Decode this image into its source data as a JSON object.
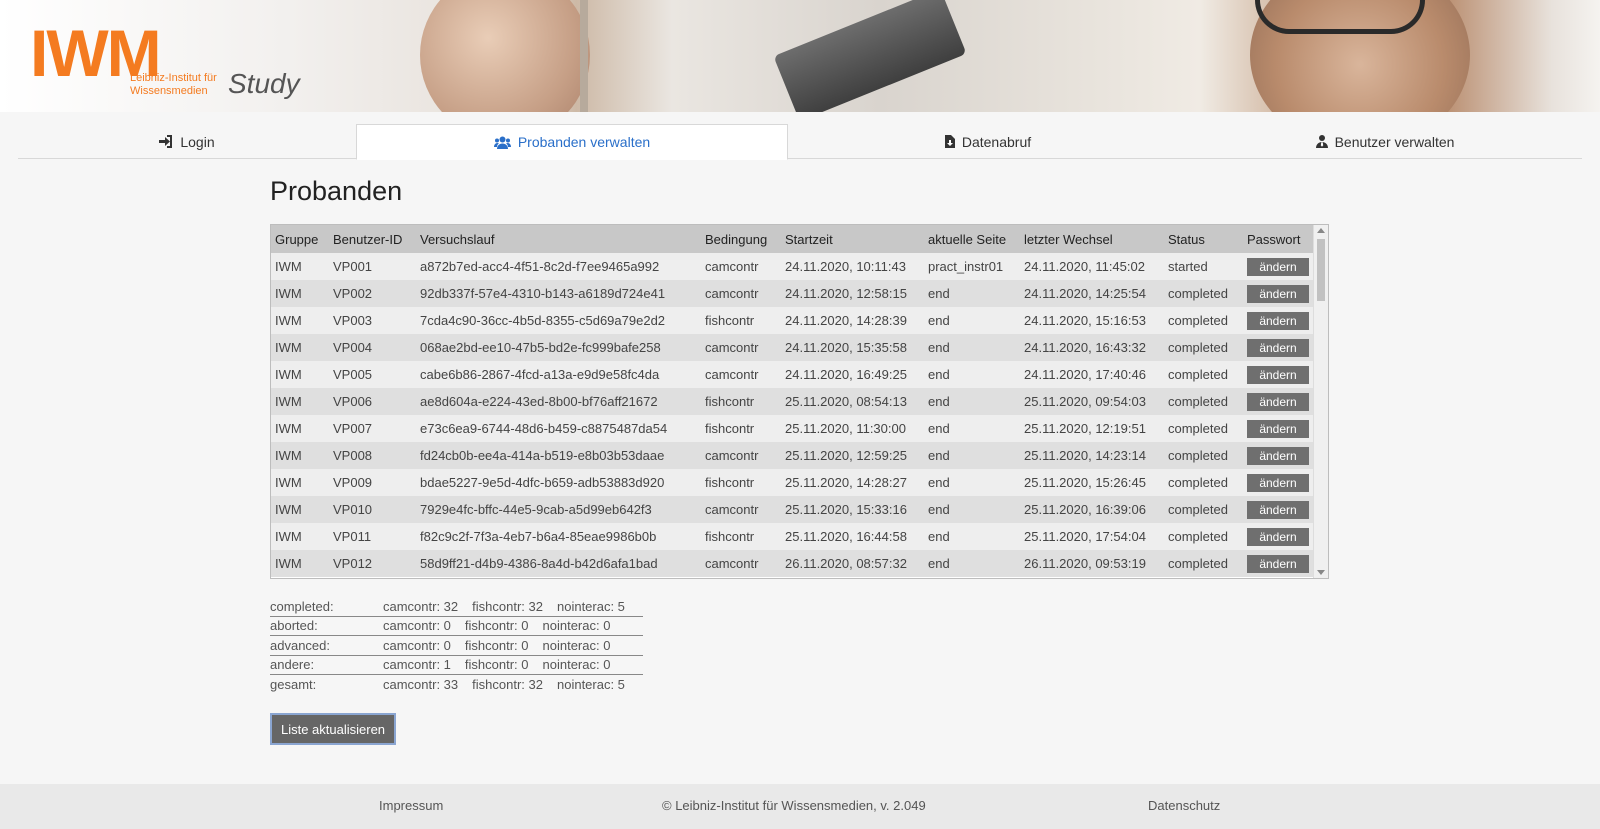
{
  "header": {
    "logo_text": "IWM",
    "logo_subtitle": "Leibniz-Institut für Wissensmedien",
    "app_name": "Study"
  },
  "tabs": [
    {
      "label": "Login",
      "icon": "sign-in-icon"
    },
    {
      "label": "Probanden verwalten",
      "icon": "users-icon",
      "active": true
    },
    {
      "label": "Datenabruf",
      "icon": "file-download-icon"
    },
    {
      "label": "Benutzer verwalten",
      "icon": "user-tie-icon"
    }
  ],
  "page_title": "Probanden",
  "table": {
    "headers": [
      "Gruppe",
      "Benutzer-ID",
      "Versuchslauf",
      "Bedingung",
      "Startzeit",
      "aktuelle Seite",
      "letzter Wechsel",
      "Status",
      "Passwort"
    ],
    "button_label": "ändern",
    "rows": [
      [
        "IWM",
        "VP001",
        "a872b7ed-acc4-4f51-8c2d-f7ee9465a992",
        "camcontr",
        "24.11.2020, 10:11:43",
        "pract_instr01",
        "24.11.2020, 11:45:02",
        "started"
      ],
      [
        "IWM",
        "VP002",
        "92db337f-57e4-4310-b143-a6189d724e41",
        "camcontr",
        "24.11.2020, 12:58:15",
        "end",
        "24.11.2020, 14:25:54",
        "completed"
      ],
      [
        "IWM",
        "VP003",
        "7cda4c90-36cc-4b5d-8355-c5d69a79e2d2",
        "fishcontr",
        "24.11.2020, 14:28:39",
        "end",
        "24.11.2020, 15:16:53",
        "completed"
      ],
      [
        "IWM",
        "VP004",
        "068ae2bd-ee10-47b5-bd2e-fc999bafe258",
        "camcontr",
        "24.11.2020, 15:35:58",
        "end",
        "24.11.2020, 16:43:32",
        "completed"
      ],
      [
        "IWM",
        "VP005",
        "cabe6b86-2867-4fcd-a13a-e9d9e58fc4da",
        "camcontr",
        "24.11.2020, 16:49:25",
        "end",
        "24.11.2020, 17:40:46",
        "completed"
      ],
      [
        "IWM",
        "VP006",
        "ae8d604a-e224-43ed-8b00-bf76aff21672",
        "fishcontr",
        "25.11.2020, 08:54:13",
        "end",
        "25.11.2020, 09:54:03",
        "completed"
      ],
      [
        "IWM",
        "VP007",
        "e73c6ea9-6744-48d6-b459-c8875487da54",
        "fishcontr",
        "25.11.2020, 11:30:00",
        "end",
        "25.11.2020, 12:19:51",
        "completed"
      ],
      [
        "IWM",
        "VP008",
        "fd24cb0b-ee4a-414a-b519-e8b03b53daae",
        "camcontr",
        "25.11.2020, 12:59:25",
        "end",
        "25.11.2020, 14:23:14",
        "completed"
      ],
      [
        "IWM",
        "VP009",
        "bdae5227-9e5d-4dfc-b659-adb53883d920",
        "fishcontr",
        "25.11.2020, 14:28:27",
        "end",
        "25.11.2020, 15:26:45",
        "completed"
      ],
      [
        "IWM",
        "VP010",
        "7929e4fc-bffc-44e5-9cab-a5d99eb642f3",
        "camcontr",
        "25.11.2020, 15:33:16",
        "end",
        "25.11.2020, 16:39:06",
        "completed"
      ],
      [
        "IWM",
        "VP011",
        "f82c9c2f-7f3a-4eb7-b6a4-85eae9986b0b",
        "fishcontr",
        "25.11.2020, 16:44:58",
        "end",
        "25.11.2020, 17:54:04",
        "completed"
      ],
      [
        "IWM",
        "VP012",
        "58d9ff21-d4b9-4386-8a4d-b42d6afa1bad",
        "camcontr",
        "26.11.2020, 08:57:32",
        "end",
        "26.11.2020, 09:53:19",
        "completed"
      ]
    ]
  },
  "summary": [
    {
      "label": "completed:",
      "values": [
        "camcontr: 32",
        "fishcontr: 32",
        "nointerac: 5"
      ]
    },
    {
      "label": "aborted:",
      "values": [
        "camcontr: 0",
        "fishcontr: 0",
        "nointerac: 0"
      ]
    },
    {
      "label": "advanced:",
      "values": [
        "camcontr: 0",
        "fishcontr: 0",
        "nointerac: 0"
      ]
    },
    {
      "label": "andere:",
      "values": [
        "camcontr: 1",
        "fishcontr: 0",
        "nointerac: 0"
      ]
    },
    {
      "label": "gesamt:",
      "values": [
        "camcontr: 33",
        "fishcontr: 32",
        "nointerac: 5"
      ]
    }
  ],
  "refresh_button": "Liste aktualisieren",
  "footer": {
    "impressum": "Impressum",
    "copyright": "© Leibniz-Institut für Wissensmedien, v. 2.049",
    "datenschutz": "Datenschutz"
  },
  "colors": {
    "brand": "#f47b20",
    "active_tab": "#2a6fc9",
    "button": "#6f6f6f"
  }
}
